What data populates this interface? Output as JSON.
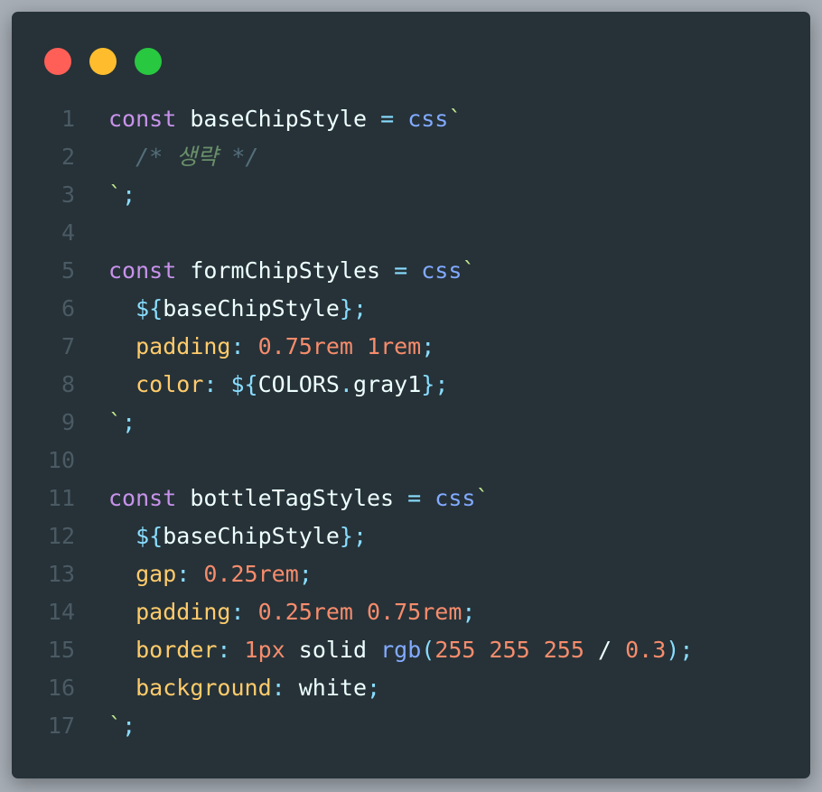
{
  "colors": {
    "close": "#ff5f57",
    "minimize": "#ffbd2e",
    "maximize": "#28c840",
    "background": "#263238"
  },
  "code": {
    "lines": [
      {
        "n": "1",
        "tokens": [
          {
            "t": "const",
            "c": "kw"
          },
          {
            "t": " ",
            "c": "plain"
          },
          {
            "t": "baseChipStyle",
            "c": "id"
          },
          {
            "t": " ",
            "c": "plain"
          },
          {
            "t": "=",
            "c": "op"
          },
          {
            "t": " ",
            "c": "plain"
          },
          {
            "t": "css",
            "c": "fn"
          },
          {
            "t": "`",
            "c": "bt"
          }
        ]
      },
      {
        "n": "2",
        "tokens": [
          {
            "t": "  ",
            "c": "plain"
          },
          {
            "t": "/*",
            "c": "cm"
          },
          {
            "t": " ",
            "c": "plain"
          },
          {
            "t": "생략",
            "c": "cmk"
          },
          {
            "t": " ",
            "c": "plain"
          },
          {
            "t": "*/",
            "c": "cm"
          }
        ]
      },
      {
        "n": "3",
        "tokens": [
          {
            "t": "`",
            "c": "bt"
          },
          {
            "t": ";",
            "c": "pun"
          }
        ]
      },
      {
        "n": "4",
        "tokens": []
      },
      {
        "n": "5",
        "tokens": [
          {
            "t": "const",
            "c": "kw"
          },
          {
            "t": " ",
            "c": "plain"
          },
          {
            "t": "formChipStyles",
            "c": "id"
          },
          {
            "t": " ",
            "c": "plain"
          },
          {
            "t": "=",
            "c": "op"
          },
          {
            "t": " ",
            "c": "plain"
          },
          {
            "t": "css",
            "c": "fn"
          },
          {
            "t": "`",
            "c": "bt"
          }
        ]
      },
      {
        "n": "6",
        "tokens": [
          {
            "t": "  ",
            "c": "plain"
          },
          {
            "t": "${",
            "c": "interp"
          },
          {
            "t": "baseChipStyle",
            "c": "id"
          },
          {
            "t": "}",
            "c": "interp"
          },
          {
            "t": ";",
            "c": "pun"
          }
        ]
      },
      {
        "n": "7",
        "tokens": [
          {
            "t": "  ",
            "c": "plain"
          },
          {
            "t": "padding",
            "c": "prop"
          },
          {
            "t": ":",
            "c": "pun"
          },
          {
            "t": " ",
            "c": "plain"
          },
          {
            "t": "0.75rem",
            "c": "num"
          },
          {
            "t": " ",
            "c": "plain"
          },
          {
            "t": "1rem",
            "c": "num"
          },
          {
            "t": ";",
            "c": "pun"
          }
        ]
      },
      {
        "n": "8",
        "tokens": [
          {
            "t": "  ",
            "c": "plain"
          },
          {
            "t": "color",
            "c": "prop"
          },
          {
            "t": ":",
            "c": "pun"
          },
          {
            "t": " ",
            "c": "plain"
          },
          {
            "t": "${",
            "c": "interp"
          },
          {
            "t": "COLORS",
            "c": "id"
          },
          {
            "t": ".",
            "c": "pun"
          },
          {
            "t": "gray1",
            "c": "id"
          },
          {
            "t": "}",
            "c": "interp"
          },
          {
            "t": ";",
            "c": "pun"
          }
        ]
      },
      {
        "n": "9",
        "tokens": [
          {
            "t": "`",
            "c": "bt"
          },
          {
            "t": ";",
            "c": "pun"
          }
        ]
      },
      {
        "n": "10",
        "tokens": []
      },
      {
        "n": "11",
        "tokens": [
          {
            "t": "const",
            "c": "kw"
          },
          {
            "t": " ",
            "c": "plain"
          },
          {
            "t": "bottleTagStyles",
            "c": "id"
          },
          {
            "t": " ",
            "c": "plain"
          },
          {
            "t": "=",
            "c": "op"
          },
          {
            "t": " ",
            "c": "plain"
          },
          {
            "t": "css",
            "c": "fn"
          },
          {
            "t": "`",
            "c": "bt"
          }
        ]
      },
      {
        "n": "12",
        "tokens": [
          {
            "t": "  ",
            "c": "plain"
          },
          {
            "t": "${",
            "c": "interp"
          },
          {
            "t": "baseChipStyle",
            "c": "id"
          },
          {
            "t": "}",
            "c": "interp"
          },
          {
            "t": ";",
            "c": "pun"
          }
        ]
      },
      {
        "n": "13",
        "tokens": [
          {
            "t": "  ",
            "c": "plain"
          },
          {
            "t": "gap",
            "c": "prop"
          },
          {
            "t": ":",
            "c": "pun"
          },
          {
            "t": " ",
            "c": "plain"
          },
          {
            "t": "0.25rem",
            "c": "num"
          },
          {
            "t": ";",
            "c": "pun"
          }
        ]
      },
      {
        "n": "14",
        "tokens": [
          {
            "t": "  ",
            "c": "plain"
          },
          {
            "t": "padding",
            "c": "prop"
          },
          {
            "t": ":",
            "c": "pun"
          },
          {
            "t": " ",
            "c": "plain"
          },
          {
            "t": "0.25rem",
            "c": "num"
          },
          {
            "t": " ",
            "c": "plain"
          },
          {
            "t": "0.75rem",
            "c": "num"
          },
          {
            "t": ";",
            "c": "pun"
          }
        ]
      },
      {
        "n": "15",
        "tokens": [
          {
            "t": "  ",
            "c": "plain"
          },
          {
            "t": "border",
            "c": "prop"
          },
          {
            "t": ":",
            "c": "pun"
          },
          {
            "t": " ",
            "c": "plain"
          },
          {
            "t": "1px",
            "c": "num"
          },
          {
            "t": " ",
            "c": "plain"
          },
          {
            "t": "solid",
            "c": "val"
          },
          {
            "t": " ",
            "c": "plain"
          },
          {
            "t": "rgb",
            "c": "fn"
          },
          {
            "t": "(",
            "c": "pun"
          },
          {
            "t": "255",
            "c": "num"
          },
          {
            "t": " ",
            "c": "plain"
          },
          {
            "t": "255",
            "c": "num"
          },
          {
            "t": " ",
            "c": "plain"
          },
          {
            "t": "255",
            "c": "num"
          },
          {
            "t": " ",
            "c": "plain"
          },
          {
            "t": "/",
            "c": "val"
          },
          {
            "t": " ",
            "c": "plain"
          },
          {
            "t": "0.3",
            "c": "num"
          },
          {
            "t": ")",
            "c": "pun"
          },
          {
            "t": ";",
            "c": "pun"
          }
        ]
      },
      {
        "n": "16",
        "tokens": [
          {
            "t": "  ",
            "c": "plain"
          },
          {
            "t": "background",
            "c": "prop"
          },
          {
            "t": ":",
            "c": "pun"
          },
          {
            "t": " ",
            "c": "plain"
          },
          {
            "t": "white",
            "c": "val"
          },
          {
            "t": ";",
            "c": "pun"
          }
        ]
      },
      {
        "n": "17",
        "tokens": [
          {
            "t": "`",
            "c": "bt"
          },
          {
            "t": ";",
            "c": "pun"
          }
        ]
      }
    ]
  }
}
